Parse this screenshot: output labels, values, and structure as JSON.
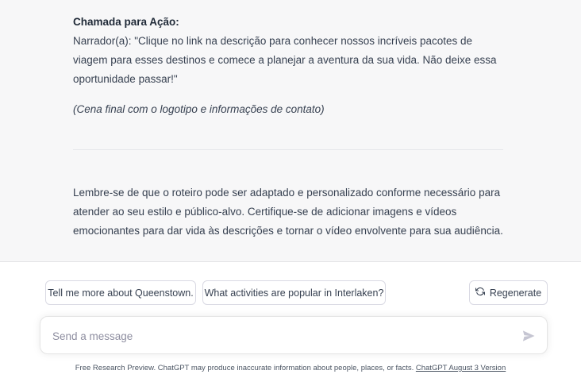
{
  "response": {
    "cta_heading": "Chamada para Ação:",
    "cta_body": "Narrador(a): \"Clique no link na descrição para conhecer nossos incríveis pacotes de viagem para esses destinos e comece a planejar a aventura da sua vida. Não deixe essa oportunidade passar!\"",
    "scene_note": "(Cena final com o logotipo e informações de contato)",
    "closing": "Lembre-se de que o roteiro pode ser adaptado e personalizado conforme necessário para atender ao seu estilo e público-alvo. Certifique-se de adicionar imagens e vídeos emocionantes para dar vida às descrições e tornar o vídeo envolvente para sua audiência."
  },
  "suggestions": [
    {
      "label": "Tell me more about Queenstown."
    },
    {
      "label": "What activities are popular in Interlaken?"
    }
  ],
  "regenerate": {
    "label": "Regenerate",
    "icon": "refresh-icon"
  },
  "composer": {
    "placeholder": "Send a message",
    "value": "",
    "send_icon": "send-icon"
  },
  "footer": {
    "text": "Free Research Preview. ChatGPT may produce inaccurate information about people, places, or facts.",
    "link": "ChatGPT August 3 Version"
  }
}
